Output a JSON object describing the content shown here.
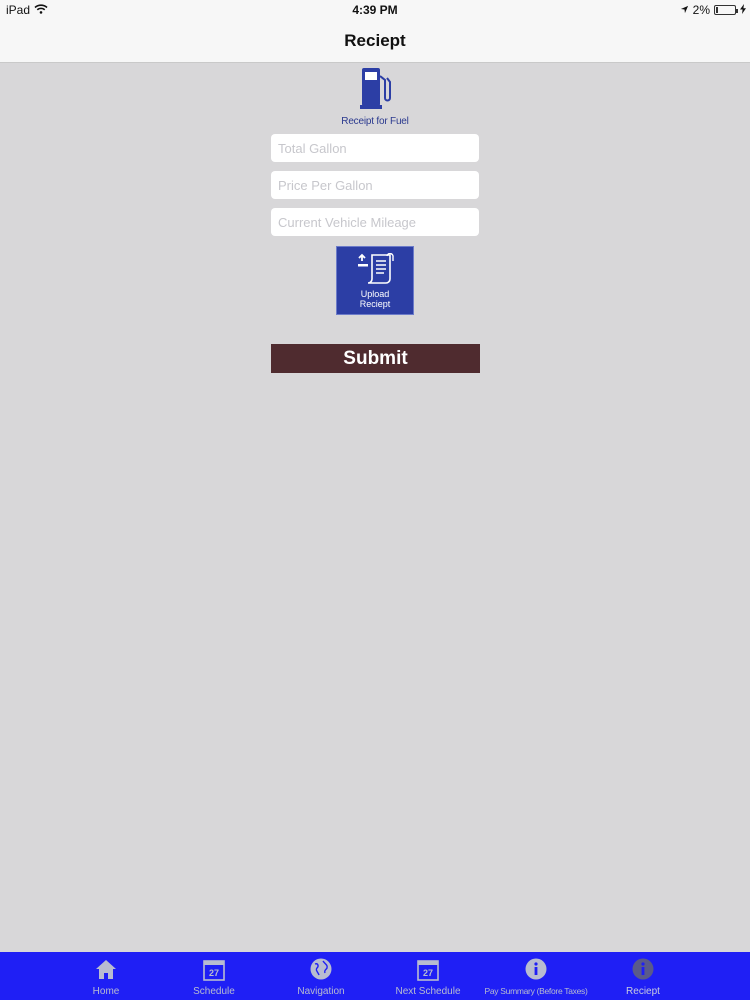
{
  "status_bar": {
    "device": "iPad",
    "time": "4:39 PM",
    "battery": "2%"
  },
  "nav": {
    "title": "Reciept"
  },
  "fuel": {
    "icon": "fuel-pump-icon",
    "caption": "Receipt for Fuel"
  },
  "form": {
    "total_gallon_placeholder": "Total Gallon",
    "price_per_gallon_placeholder": "Price Per Gallon",
    "mileage_placeholder": "Current Vehicle Mileage",
    "upload_label": "Upload\nReciept",
    "submit_label": "Submit"
  },
  "tabs": [
    {
      "label": "Home",
      "icon": "home-icon"
    },
    {
      "label": "Schedule",
      "icon": "calendar-icon",
      "day": "27"
    },
    {
      "label": "Navigation",
      "icon": "globe-icon"
    },
    {
      "label": "Next Schedule",
      "icon": "calendar-icon",
      "day": "27"
    },
    {
      "label": "Pay Summary (Before Taxes)",
      "icon": "info-icon"
    },
    {
      "label": "Reciept",
      "icon": "info-icon"
    }
  ],
  "colors": {
    "tab_bar": "#1f1ff5",
    "upload_button": "#2c3ea5",
    "submit_button": "#4f2b2f",
    "background": "#d8d7d9"
  }
}
